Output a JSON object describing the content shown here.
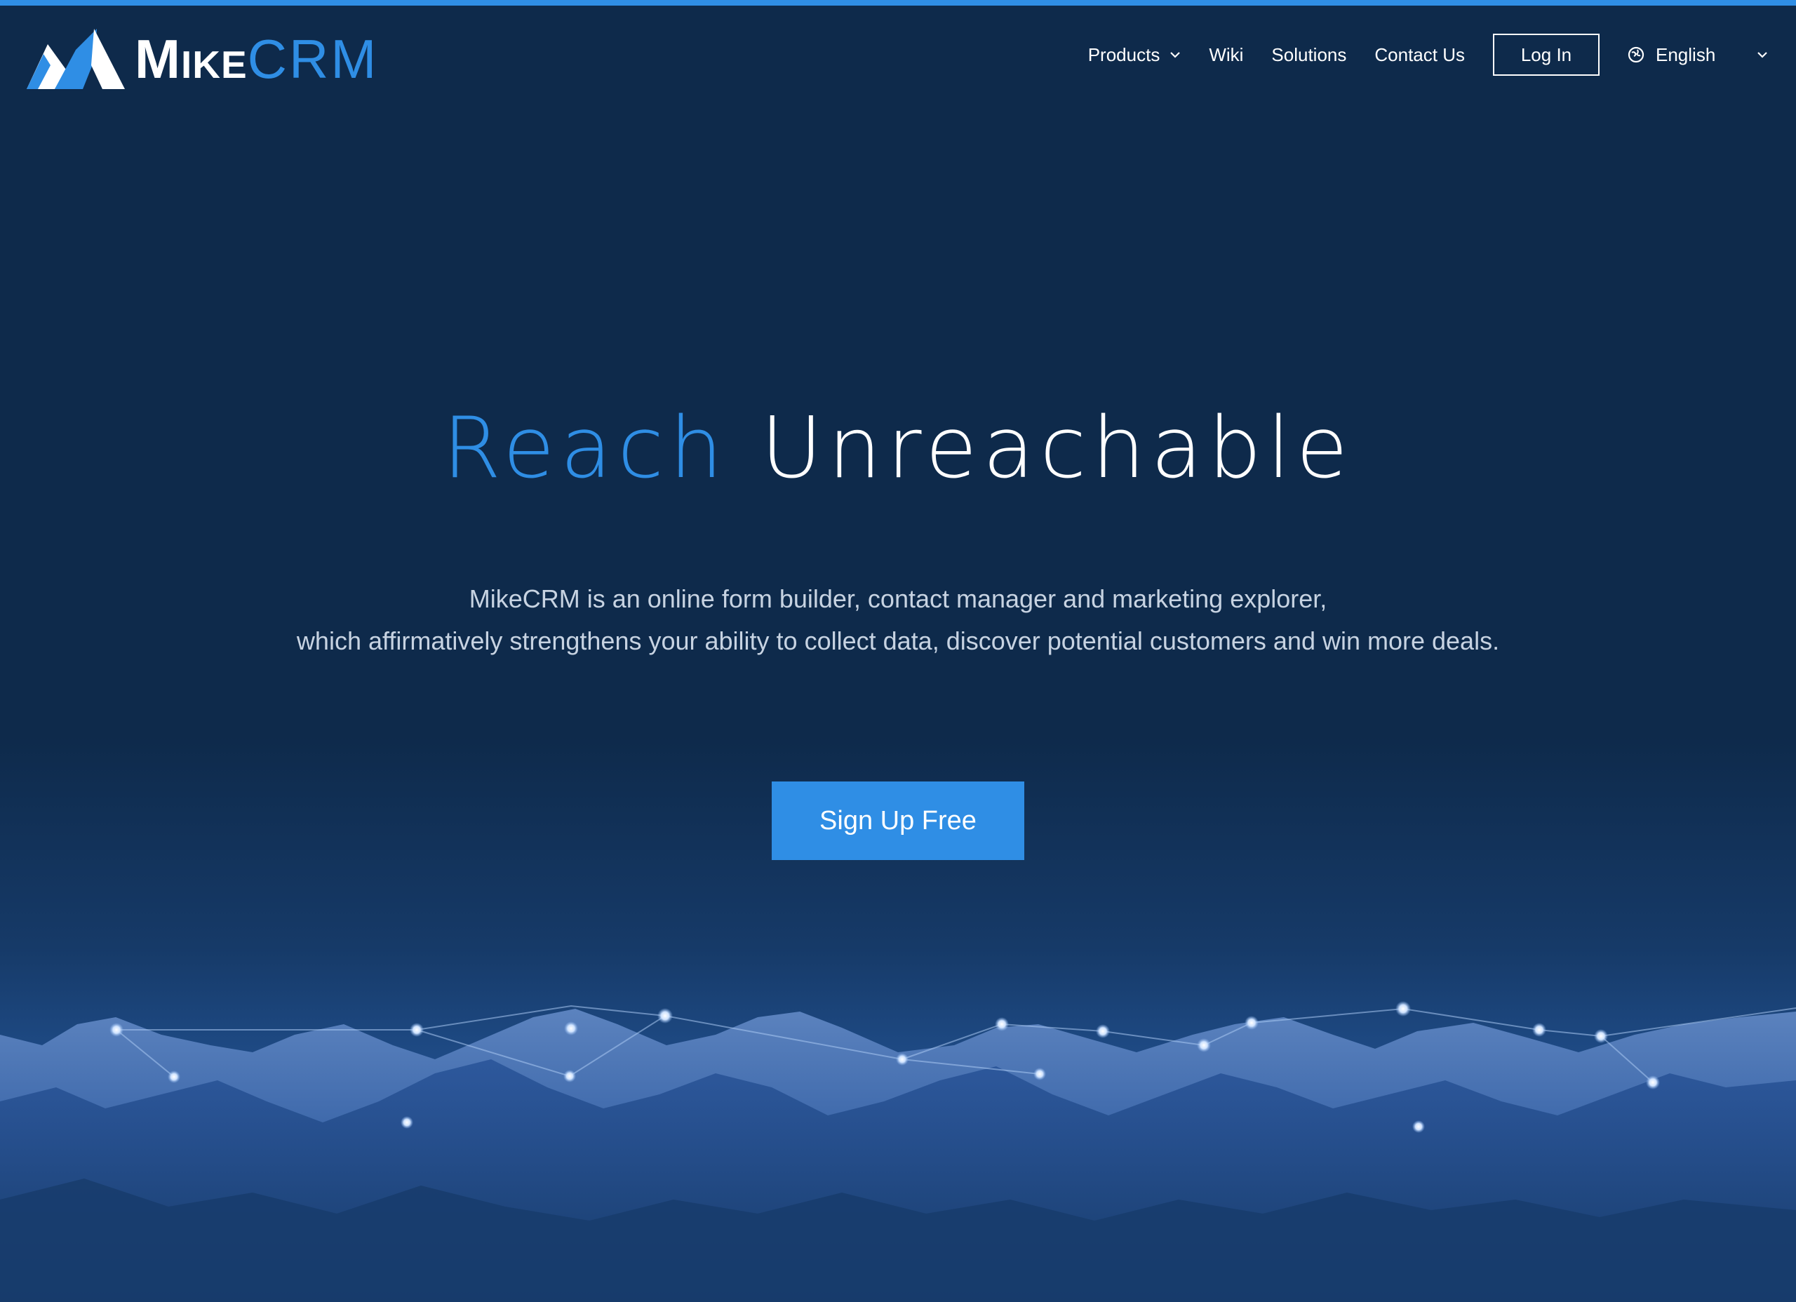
{
  "brand": {
    "name_part1": "Mike",
    "name_part2": "CRM",
    "accent_color": "#2f8ee5",
    "background_color": "#0e2a4b"
  },
  "nav": {
    "items": [
      {
        "label": "Products",
        "has_dropdown": true
      },
      {
        "label": "Wiki"
      },
      {
        "label": "Solutions"
      },
      {
        "label": "Contact Us"
      }
    ],
    "login_label": "Log In",
    "language": {
      "selected": "English",
      "icon": "globe-icon"
    }
  },
  "hero": {
    "headline_part1": "Reach",
    "headline_part2": "Unreachable",
    "description_line1": "MikeCRM is an online form builder, contact manager and marketing explorer,",
    "description_line2": "which affirmatively strengthens your ability to collect data, discover potential customers and win more deals.",
    "cta_label": "Sign Up Free"
  }
}
